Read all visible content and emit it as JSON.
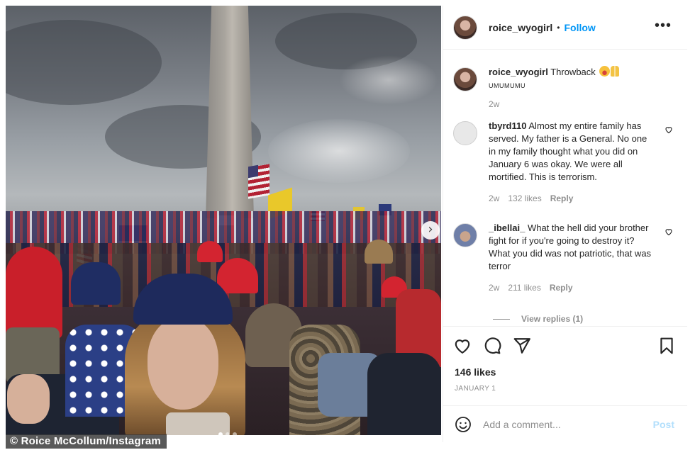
{
  "photo": {
    "credit": "© Roice McCollum/Instagram",
    "next_arrow_icon": "chevron-right-icon",
    "carousel_dots": 3,
    "active_dot": 1
  },
  "header": {
    "username": "roice_wyogirl",
    "follow_label": "Follow",
    "more_icon": "ellipsis-icon"
  },
  "caption": {
    "username": "roice_wyogirl",
    "text": "Throwback",
    "tail_text": "UMUMUMU",
    "time": "2w"
  },
  "comments": [
    {
      "username": "tbyrd110",
      "text": "Almost my entire family has served. My father is a General. No one in my family thought what you did on January 6 was okay. We were all mortified. This is terrorism.",
      "time": "2w",
      "likes": "132 likes",
      "reply_label": "Reply"
    },
    {
      "username": "_ibellai_",
      "text": "What the hell did your brother fight for if you're going to destroy it? What you did was not patriotic, that was terror",
      "time": "2w",
      "likes": "211 likes",
      "reply_label": "Reply"
    }
  ],
  "view_replies": "View replies (1)",
  "actions": {
    "like_icon": "heart-icon",
    "comment_icon": "comment-icon",
    "share_icon": "send-icon",
    "save_icon": "bookmark-icon"
  },
  "likes": "146 likes",
  "date": "JANUARY 1",
  "comment_box": {
    "emoji_icon": "smile-icon",
    "placeholder": "Add a comment...",
    "post_label": "Post"
  }
}
